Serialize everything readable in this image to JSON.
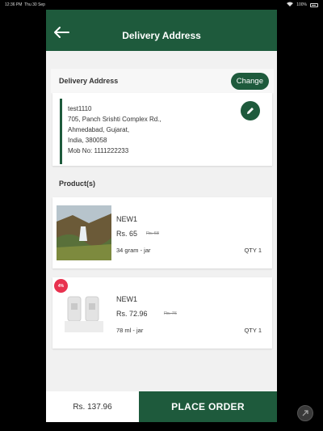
{
  "status_bar": {
    "time": "12:36 PM",
    "date": "Thu 30 Sep",
    "battery": "100%"
  },
  "appbar": {
    "title": "Delivery Address",
    "back_icon": "arrow-left-icon"
  },
  "address_section": {
    "title": "Delivery Address",
    "change_label": "Change",
    "lines": [
      "test1110",
      "705, Panch Srishti Complex Rd.,",
      "Ahmedabad, Gujarat,",
      "India, 380058",
      "Mob No: 1111222233"
    ],
    "edit_icon": "pencil-icon"
  },
  "products_title": "Product(s)",
  "products": [
    {
      "name": "NEW1",
      "price": "Rs. 65",
      "mrp": "Rs. 68",
      "size": "34 gram - jar",
      "qty": "QTY 1"
    },
    {
      "name": "NEW1",
      "price": "Rs. 72.96",
      "mrp": "Rs. 76",
      "size": "78 ml - jar",
      "qty": "QTY 1",
      "badge": "4%"
    }
  ],
  "footer": {
    "total": "Rs. 137.96",
    "place_order": "PLACE ORDER"
  },
  "colors": {
    "primary": "#1e5a3c",
    "badge": "#e8324f",
    "background": "#f1f1f1"
  }
}
